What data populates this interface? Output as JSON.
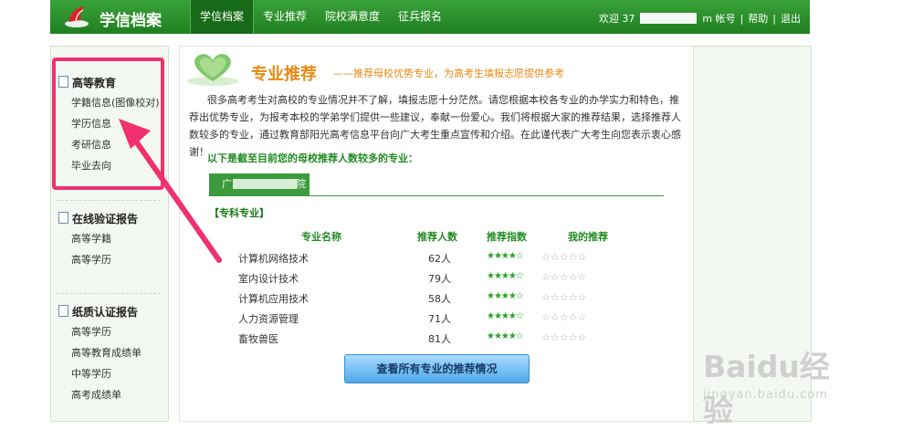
{
  "header": {
    "brand": "学信档案",
    "nav": [
      "学信档案",
      "专业推荐",
      "院校满意度",
      "征兵报名"
    ],
    "welcome": "欢迎 37",
    "account_suffix": "m 帐号",
    "help": "帮助",
    "logout": "退出",
    "separator": "|"
  },
  "sidebar": {
    "groups": [
      {
        "title": "高等教育",
        "items": [
          "学籍信息(图像校对)",
          "学历信息",
          "考研信息",
          "毕业去向"
        ]
      },
      {
        "title": "在线验证报告",
        "items": [
          "高等学籍",
          "高等学历"
        ]
      },
      {
        "title": "纸质认证报告",
        "items": [
          "高等学历",
          "高等教育成绩单",
          "中等学历",
          "高考成绩单"
        ]
      }
    ]
  },
  "main": {
    "title": "专业推荐",
    "subtitle": "——推荐母校优势专业，为高考生填报志愿提供参考",
    "intro": "很多高考考生对高校的专业情况并不了解，填报志愿十分茫然。请您根据本校各专业的办学实力和特色，推荐出优势专业，为报考本校的学弟学们提供一些建议，奉献一份爱心。我们将根据大家的推荐结果，选择推荐人数较多的专业，通过教育部阳光高考信息平台向广大考生重点宣传和介绍。在此谨代表广大考生向您表示衷心感谢！",
    "up_label": "以下是截至目前您的母校推荐人数较多的专业：",
    "school_tab_start": "广",
    "school_tab_end": "院",
    "category": "【专科专业】",
    "table": {
      "headers": [
        "专业名称",
        "推荐人数",
        "推荐指数",
        "我的推荐"
      ],
      "rows": [
        {
          "name": "计算机网络技术",
          "count": "62人",
          "stars": 4
        },
        {
          "name": "室内设计技术",
          "count": "79人",
          "stars": 4
        },
        {
          "name": "计算机应用技术",
          "count": "58人",
          "stars": 4
        },
        {
          "name": "人力资源管理",
          "count": "71人",
          "stars": 4
        },
        {
          "name": "畜牧兽医",
          "count": "81人",
          "stars": 4
        }
      ],
      "max_stars": 5
    },
    "view_all": "查看所有专业的推荐情况"
  },
  "watermark": {
    "main": "Baidu经验",
    "sub": "jingyan.baidu.com"
  },
  "colors": {
    "header_green": "#2f962f",
    "accent_orange": "#e88a12",
    "highlight_pink": "#f0306f",
    "star_green": "#27a327"
  }
}
